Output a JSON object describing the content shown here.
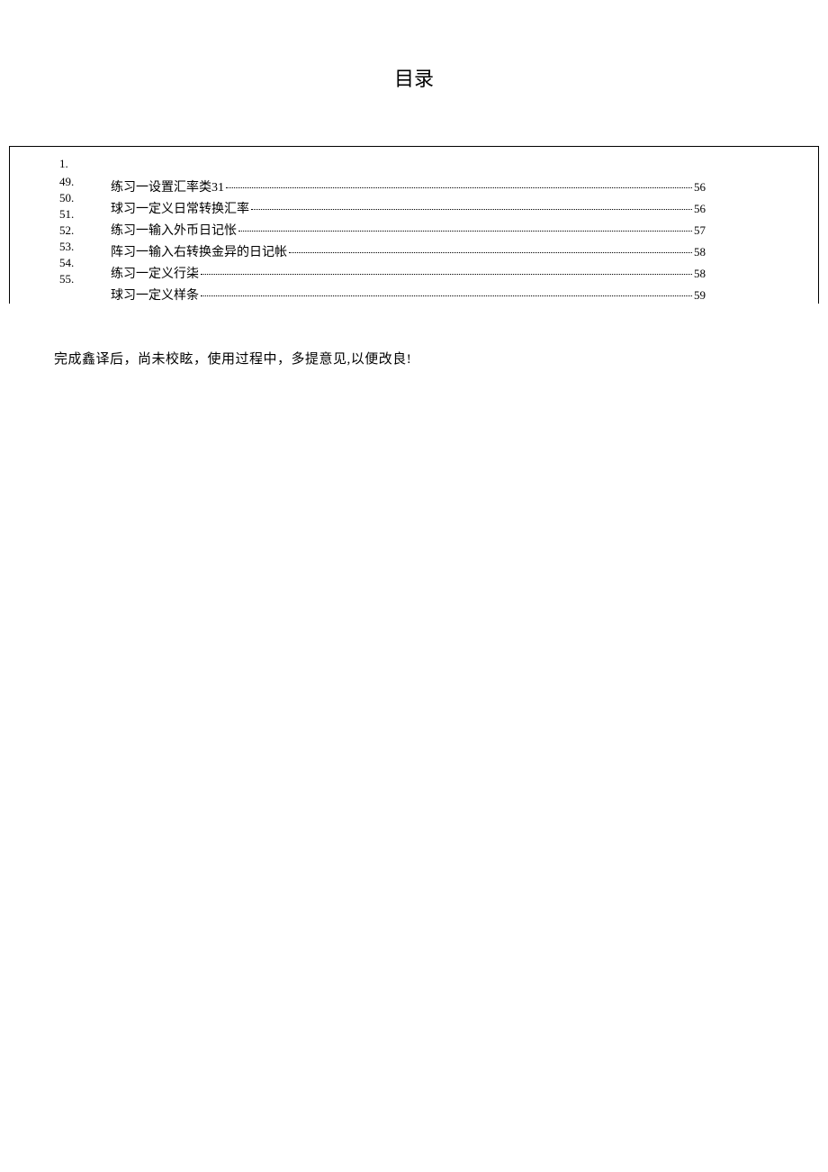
{
  "title": "目录",
  "toc": {
    "numbers": [
      "1.",
      "49.",
      "50.",
      "51.",
      "52.",
      "53.",
      "54.",
      "55."
    ],
    "entries": [
      {
        "title": "练习一设置汇率类31",
        "page": "56"
      },
      {
        "title": "球习一定义日常转换汇率",
        "page": "56"
      },
      {
        "title": "练习一输入外币日记怅",
        "page": "57"
      },
      {
        "title": "阵习一输入右转换金异的日记帐",
        "page": "58"
      },
      {
        "title": "练习一定义行柒",
        "page": "58"
      },
      {
        "title": "球习一定义样条",
        "page": "59"
      }
    ]
  },
  "note": "完成鑫译后，尚未校眩，使用过程中，多提意见,以便改良!"
}
